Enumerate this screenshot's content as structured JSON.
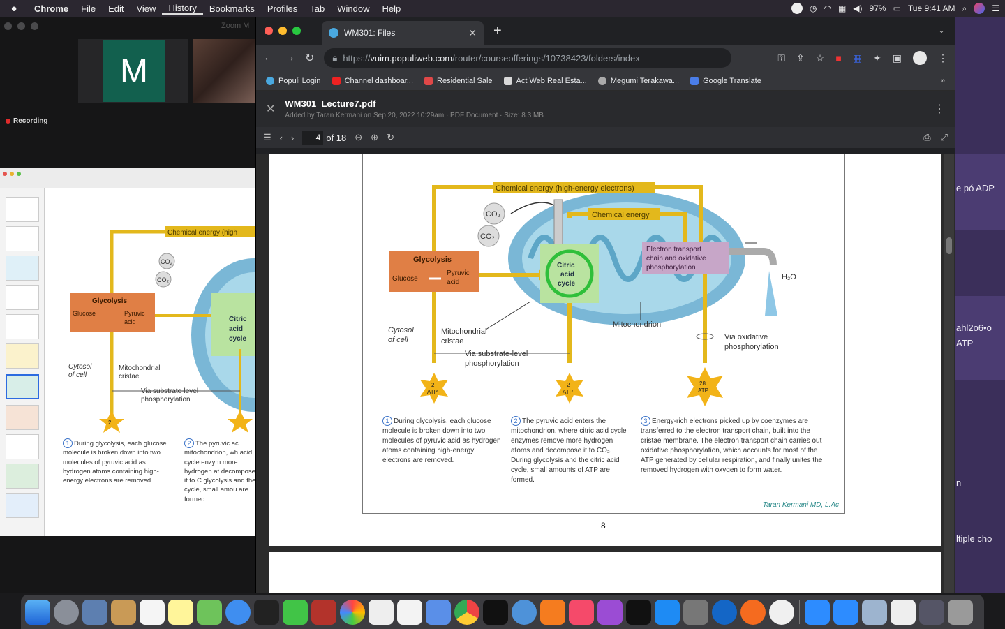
{
  "menubar": {
    "app": "Chrome",
    "items": [
      "File",
      "Edit",
      "View",
      "History",
      "Bookmarks",
      "Profiles",
      "Tab",
      "Window",
      "Help"
    ],
    "battery": "97%",
    "clock": "Tue 9:41 AM"
  },
  "zoom": {
    "title": "Zoom M",
    "participant_initial": "M",
    "recording": "Recording"
  },
  "chrome": {
    "tab_title": "WM301: Files",
    "url_prefix": "https://",
    "url_host": "vuim.populiweb.com",
    "url_path": "/router/courseofferings/10738423/folders/index",
    "bookmarks": [
      "Populi Login",
      "Channel dashboar...",
      "Residential Sale",
      "Act Web Real Esta...",
      "Megumi Terakawa...",
      "Google Translate"
    ],
    "bookmarks_more": "»"
  },
  "file": {
    "name": "WM301_Lecture7.pdf",
    "meta": "Added by Taran Kermani on Sep 20, 2022 10:29am  ·  PDF Document  ·  Size: 8.3 MB"
  },
  "pdf": {
    "current_page": "4",
    "page_count": "of 18",
    "printed_page_number": "8"
  },
  "diagram": {
    "label_chemical_energy_high": "Chemical energy (high-energy electrons)",
    "label_chemical_energy": "Chemical energy",
    "co2": "CO₂",
    "glycolysis": "Glycolysis",
    "glucose": "Glucose",
    "pyruvic_acid": "Pyruvic acid",
    "citric_acid_cycle": "Citric acid cycle",
    "etc": "Electron transport chain and oxidative phosphorylation",
    "h2o": "H₂O",
    "cytosol": "Cytosol of cell",
    "cristae": "Mitochondrial cristae",
    "mitochondrion": "Mitochondrion",
    "substrate": "Via substrate-level phosphorylation",
    "oxidative": "Via oxidative phosphorylation",
    "atp1_num": "2",
    "atp2_num": "2",
    "atp3_num": "28",
    "atp_word": "ATP",
    "step1_num": "1",
    "step2_num": "2",
    "step3_num": "3",
    "step1": "During glycolysis, each glucose molecule is broken down into two molecules of pyruvic acid as hydrogen atoms containing high-energy electrons are removed.",
    "step2": "The pyruvic acid enters the mitochondrion, where citric acid cycle enzymes remove more hydrogen atoms and decompose it to CO₂. During glycolysis and the citric acid cycle, small amounts of ATP are formed.",
    "step3": "Energy-rich electrons picked up by coenzymes are transferred to the electron transport chain, built into the cristae membrane. The electron transport chain carries out oxidative phosphorylation, which accounts for most of the ATP generated by cellular respiration, and finally unites the removed hydrogen with oxygen to form water.",
    "credit": "Taran Kermani MD, L.Ac"
  },
  "shared_slide": {
    "label_chemical_energy": "Chemical energy (high",
    "glycolysis": "Glycolysis",
    "glucose": "Glucose",
    "pyruvic_acid": "Pyruvic acid",
    "citric": "Citric acid cycle",
    "cytosol": "Cytosol of cell",
    "cristae": "Mitochondrial cristae",
    "substrate": "Via substrate-level phosphorylation",
    "atp_num": "2",
    "step1": "During glycolysis, each glucose molecule is broken down into two molecules of pyruvic acid as hydrogen atoms containing high-energy electrons are removed.",
    "step2": "The pyruvic ac mitochondrion, wh acid cycle enzym more hydrogen at decompose it to C glycolysis and the cycle, small amou are formed."
  },
  "right_panel": {
    "texts": [
      "e pó ADP",
      "ahl2o6•o",
      "ATP",
      "n",
      "ltiple cho"
    ]
  },
  "colors": {
    "yellow_arrow": "#e3b81c",
    "glycolysis_box": "#e07f45",
    "citric_box": "#b9e3a0",
    "etc_box": "#c7a6c8",
    "mito_outer": "#7ab7d6"
  }
}
